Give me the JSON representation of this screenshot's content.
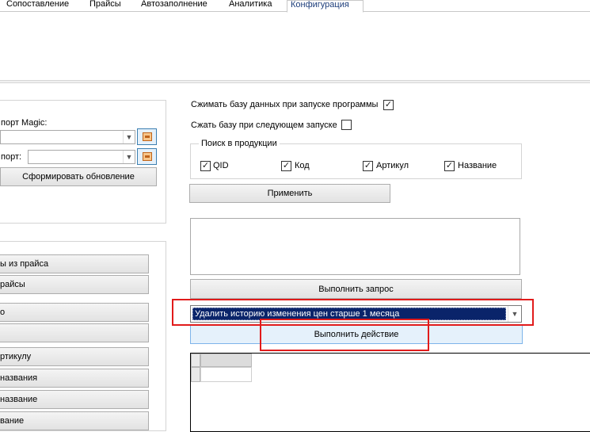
{
  "tabs": [
    {
      "label": "Сопоставление"
    },
    {
      "label": "Прайсы"
    },
    {
      "label": "Автозаполнение"
    },
    {
      "label": "Аналитика"
    },
    {
      "label": "Конфигурация"
    }
  ],
  "left_top": {
    "magic_label": "порт Magic:",
    "export_label": "порт:",
    "generate_button": "Сформировать обновление"
  },
  "left_buttons": [
    {
      "label": "ы из прайса"
    },
    {
      "label": "райсы"
    },
    {
      "label": "о"
    },
    {
      "label": ""
    },
    {
      "label": "ртикулу"
    },
    {
      "label": " названия"
    },
    {
      "label": " название"
    },
    {
      "label": "вание"
    }
  ],
  "config": {
    "compress_on_start_label": "Сжимать базу данных при запуске программы",
    "compress_on_start_checked": true,
    "compress_next_label": "Сжать базу при следующем запуске",
    "compress_next_checked": false,
    "search_group_title": "Поиск в продукции",
    "search_options": [
      {
        "label": "QID",
        "checked": true
      },
      {
        "label": "Код",
        "checked": true
      },
      {
        "label": "Артикул",
        "checked": true
      },
      {
        "label": "Название",
        "checked": true
      }
    ],
    "apply_button": "Применить",
    "query_text": "",
    "run_query_button": "Выполнить запрос",
    "action_selected": "Удалить историю изменения цен старше 1 месяца",
    "run_action_button": "Выполнить действие"
  },
  "colors": {
    "selection": "#0a246a",
    "highlight_box": "#e11b1b",
    "active_tab_text": "#1c3d7a",
    "button_hover": "#e5f1fb"
  }
}
